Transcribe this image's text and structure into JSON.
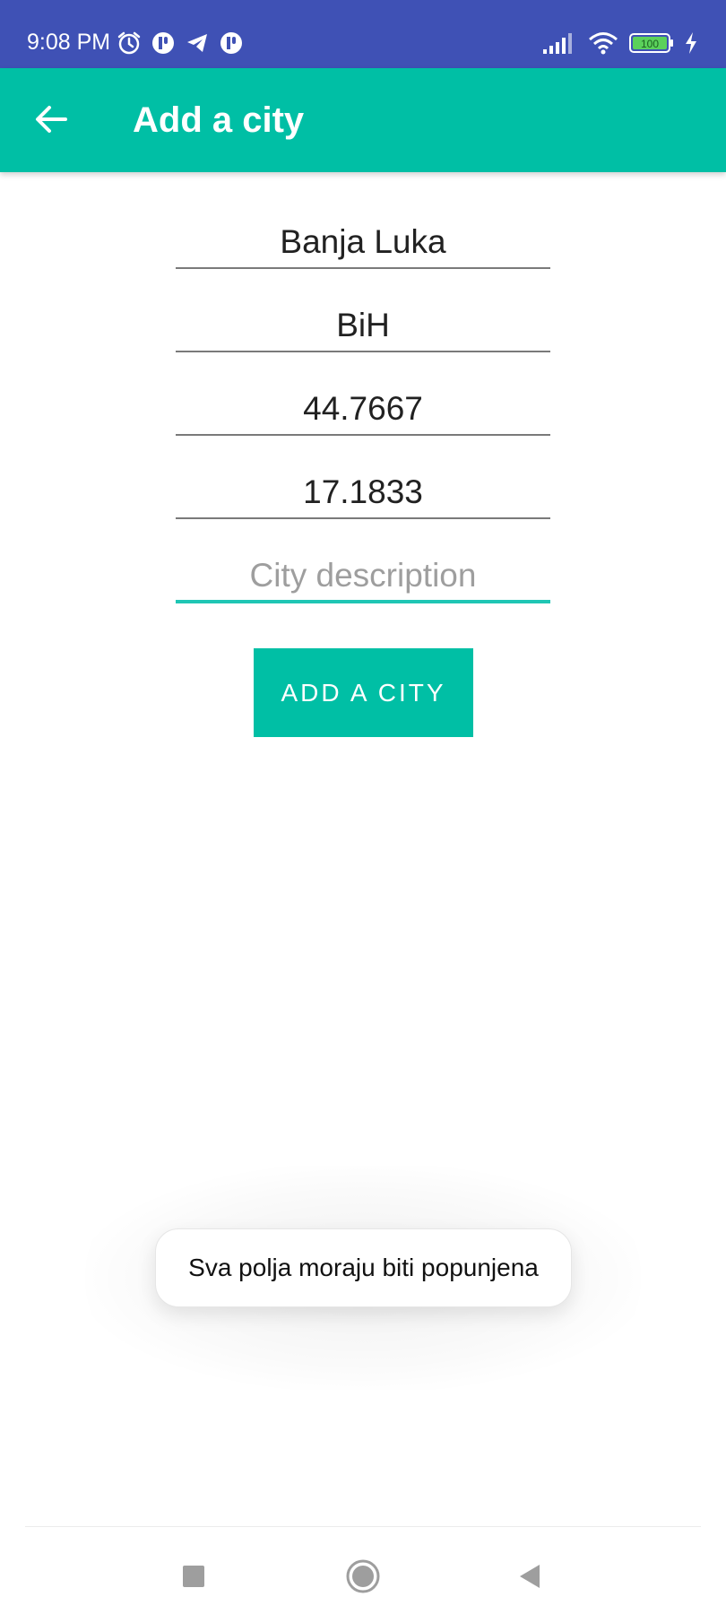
{
  "status_bar": {
    "time": "9:08 PM",
    "left_icons": [
      "alarm-icon",
      "app-notification-icon",
      "telegram-icon",
      "app-notification-icon"
    ],
    "right_icons": [
      "signal-icon",
      "wifi-icon",
      "battery-icon",
      "charging-icon"
    ],
    "battery_level": "100"
  },
  "app_bar": {
    "title": "Add a city",
    "back_icon": "arrow-back-icon"
  },
  "form": {
    "fields": [
      {
        "value": "Banja Luka",
        "placeholder": ""
      },
      {
        "value": "BiH",
        "placeholder": ""
      },
      {
        "value": "44.7667",
        "placeholder": ""
      },
      {
        "value": "17.1833",
        "placeholder": ""
      },
      {
        "value": "",
        "placeholder": "City description"
      }
    ],
    "submit_label": "ADD A CITY"
  },
  "toast": {
    "message": "Sva polja moraju biti popunjena"
  },
  "nav_bar": {
    "buttons": [
      "recents-square-icon",
      "home-circle-icon",
      "back-triangle-icon"
    ]
  },
  "colors": {
    "status_bar": "#3f51b5",
    "primary": "#00bfa5",
    "focus_underline": "#1fc6b4",
    "background": "#ffffff"
  }
}
